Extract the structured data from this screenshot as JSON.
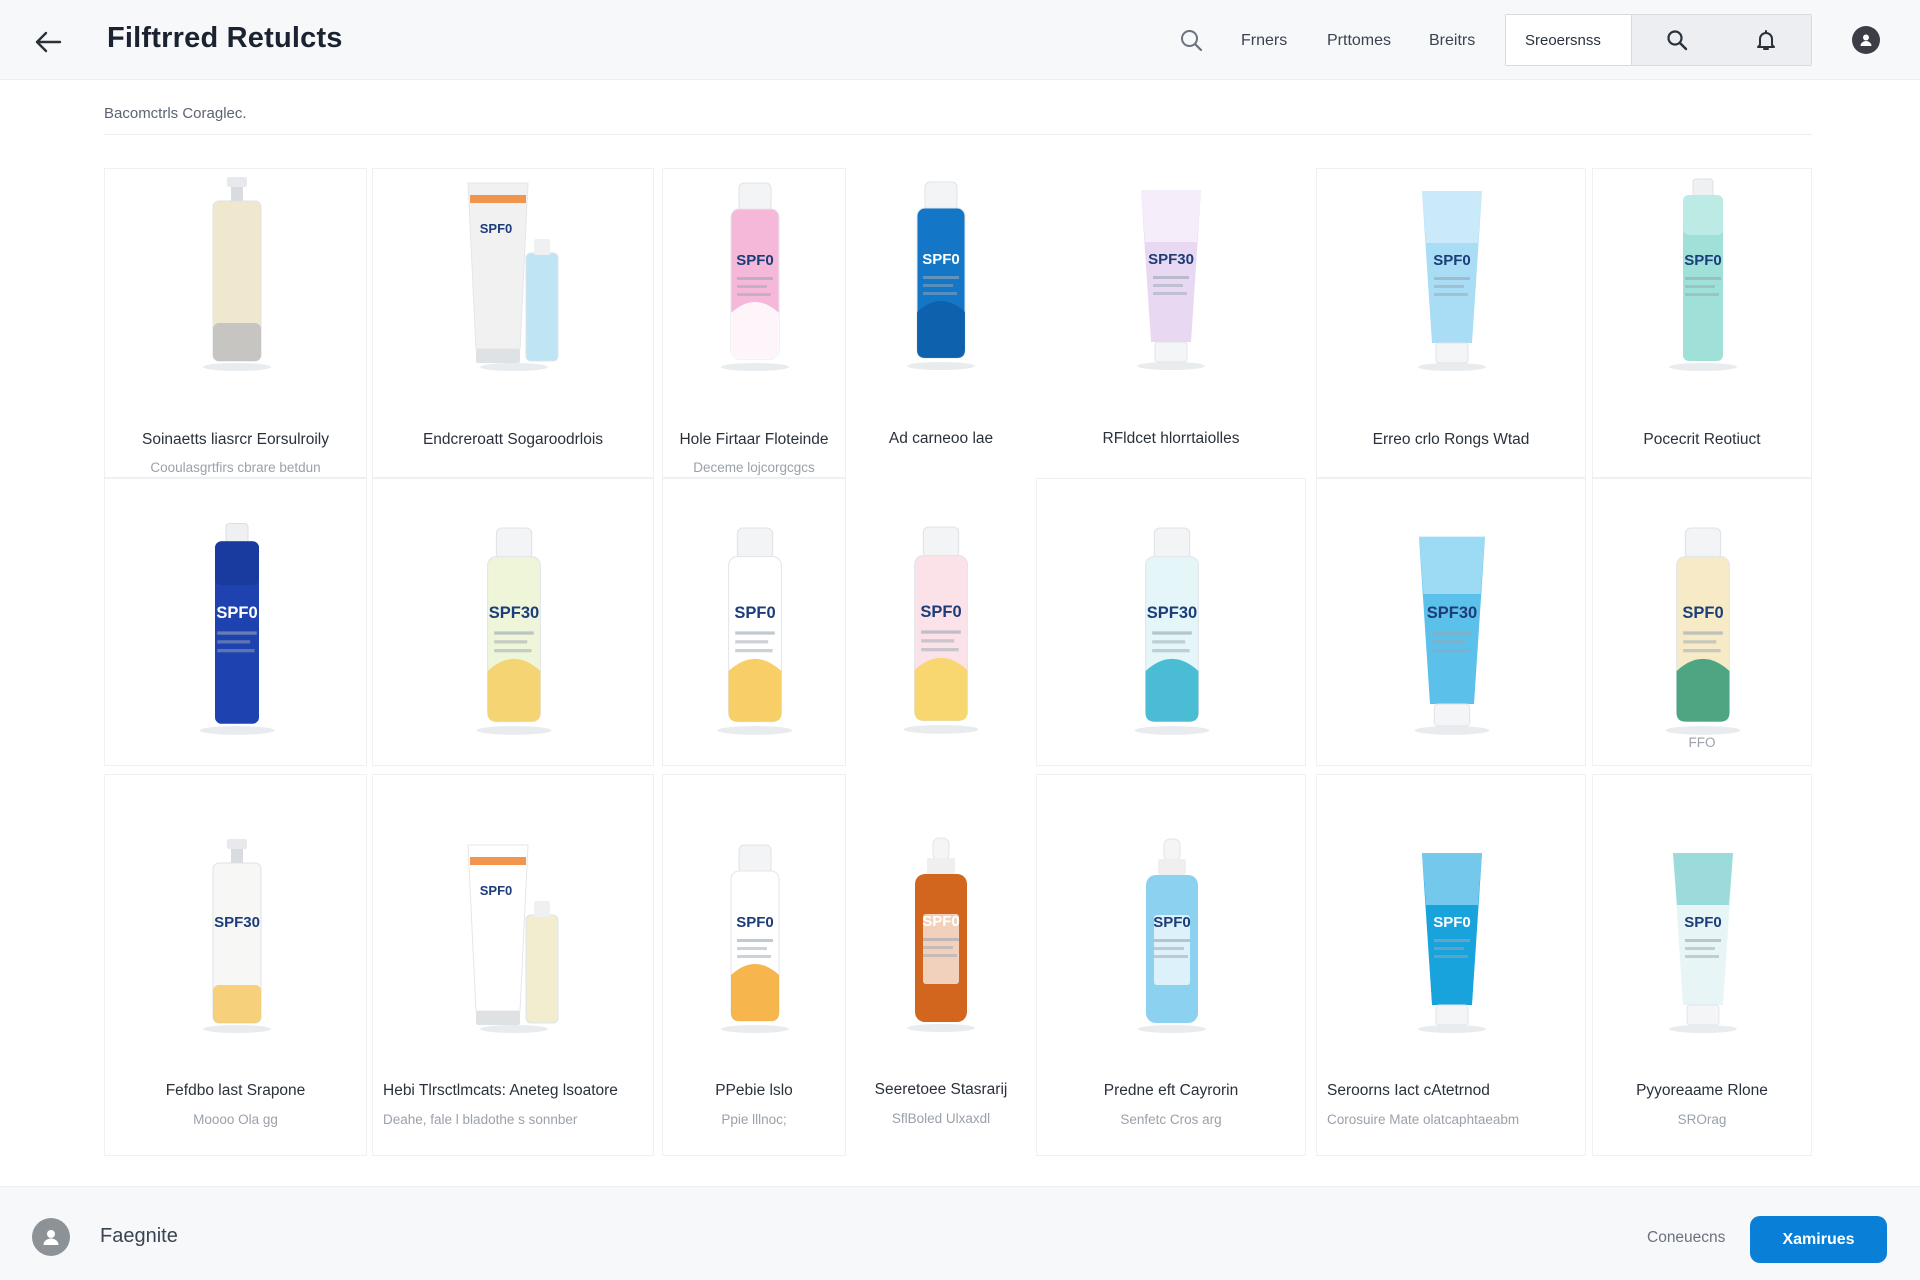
{
  "header": {
    "title": "Filftrred Retulcts",
    "nav": [
      "Frners",
      "Prttomes",
      "Breitrs"
    ],
    "search_placeholder": "Sreoersnss"
  },
  "subtitle": "Bacomctrls Coraglec.",
  "products": [
    {
      "name": "Soinaetts liasrcr Eorsulroily",
      "sub": "Cooulasgrtfirs cbrare betdun",
      "style": "pump",
      "colors": [
        "#efe8cf",
        "#b9b9bd"
      ],
      "label": ""
    },
    {
      "name": "Endcreroatt Sogaroodrlois",
      "sub": "",
      "style": "tube-pair",
      "colors": [
        "#f2f1f2",
        "#bfe4f4"
      ],
      "label": "SPF0"
    },
    {
      "name": "Hole Firtaar Floteinde",
      "sub": "Deceme lojcorgcgcs",
      "style": "bottle",
      "colors": [
        "#f5b8d9",
        "#ffffff"
      ],
      "label": "SPF0"
    },
    {
      "name": "Ad carneoo lae",
      "sub": "",
      "style": "bottle",
      "colors": [
        "#1476c6",
        "#0d5ea8"
      ],
      "label": "SPF0"
    },
    {
      "name": "RFldcet hlorrtaiolles",
      "sub": "",
      "style": "tube",
      "colors": [
        "#e8d8f2",
        "#ffffff"
      ],
      "label": "SPF30"
    },
    {
      "name": "Erreo crlo Rongs Wtad",
      "sub": "",
      "style": "tube",
      "colors": [
        "#a9dcf5",
        "#e6f5fc"
      ],
      "label": "SPF0"
    },
    {
      "name": "Pocecrit Reotiuct",
      "sub": "",
      "style": "tall",
      "colors": [
        "#9fe0d9",
        "#d9f4f0"
      ],
      "label": "SPF0"
    },
    {
      "name": "",
      "sub": "",
      "style": "tall",
      "colors": [
        "#1e43b0",
        "#14318c"
      ],
      "label": "SPF0"
    },
    {
      "name": "",
      "sub": "",
      "style": "bottle",
      "colors": [
        "#eef5d8",
        "#f6cf62"
      ],
      "label": "SPF30"
    },
    {
      "name": "",
      "sub": "",
      "style": "bottle",
      "colors": [
        "#ffffff",
        "#f7c74c"
      ],
      "label": "SPF0"
    },
    {
      "name": "",
      "sub": "",
      "style": "bottle",
      "colors": [
        "#fbe2e8",
        "#f7d35a"
      ],
      "label": "SPF0"
    },
    {
      "name": "",
      "sub": "",
      "style": "bottle",
      "colors": [
        "#e4f6f8",
        "#2fb3cf"
      ],
      "label": "SPF30"
    },
    {
      "name": "",
      "sub": "",
      "style": "tube",
      "colors": [
        "#5bc0ea",
        "#d3effa"
      ],
      "label": "SPF30"
    },
    {
      "name": "",
      "sub": "FFO",
      "style": "bottle",
      "colors": [
        "#f6ebc6",
        "#2f9a74"
      ],
      "label": "SPF0"
    },
    {
      "name": "Fefdbo last Srapone",
      "sub": "Moooo Ola gg",
      "style": "pump",
      "colors": [
        "#f7f7f5",
        "#f6c351"
      ],
      "label": "SPF30"
    },
    {
      "name": "Hebi Tlrsctlmcats: Aneteg lsoatore",
      "sub": "Deahe, fale l bladothe s sonnber",
      "style": "tube-pair",
      "colors": [
        "#ffffff",
        "#f2edcf"
      ],
      "label": "SPF0"
    },
    {
      "name": "PPebie lslo",
      "sub": "Ppie lllnoc;",
      "style": "bottle",
      "colors": [
        "#ffffff",
        "#f4a92e"
      ],
      "label": "SPF0"
    },
    {
      "name": "Seeretoee Stasrarij",
      "sub": "SflBoled Ulxaxdl",
      "style": "dropper",
      "colors": [
        "#d3661e",
        "#f0a25b"
      ],
      "label": "SPF0"
    },
    {
      "name": "Predne eft Cayrorin",
      "sub": "Senfetc Cros arg",
      "style": "dropper",
      "colors": [
        "#8cd1ef",
        "#c4e8f7"
      ],
      "label": "SPF0"
    },
    {
      "name": "Seroorns Iact cAtetrnod",
      "sub": "Corosuire Mate olatcaphtaeabm",
      "style": "tube",
      "colors": [
        "#18a3dd",
        "#bfe8f8"
      ],
      "label": "SPF0"
    },
    {
      "name": "Pyyoreaame Rlone",
      "sub": "SROrag",
      "style": "tube",
      "colors": [
        "#e7f5f6",
        "#5dc5c7"
      ],
      "label": "SPF0"
    }
  ],
  "footer": {
    "label": "Faegnite",
    "secondary": "Coneuecns",
    "primary": "Xamirues"
  },
  "colors": {
    "accent": "#0a7fd8",
    "header_bg": "#f7f8fa"
  }
}
